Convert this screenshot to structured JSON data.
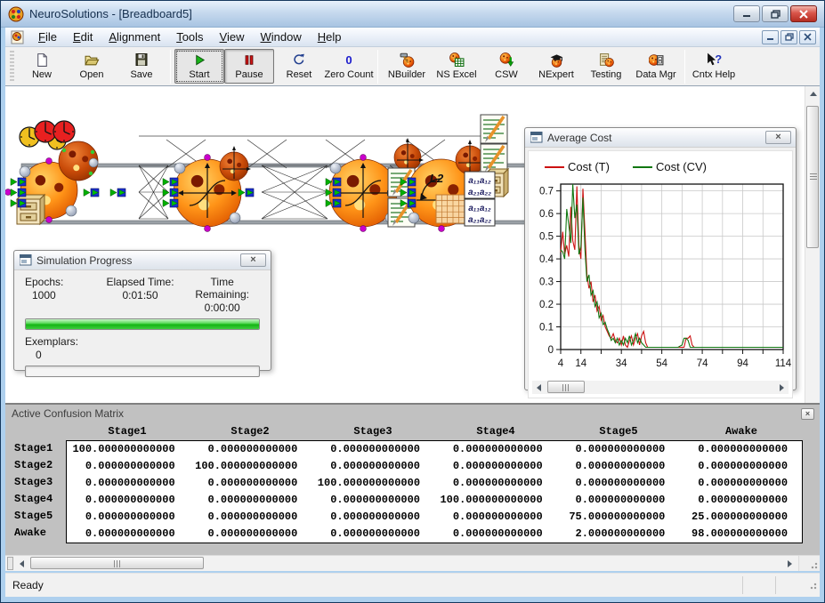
{
  "window": {
    "title": "NeuroSolutions - [Breadboard5]",
    "controls": [
      "minimize-icon",
      "restore-icon",
      "close-icon"
    ],
    "mdi_controls": [
      "minimize-icon",
      "restore-icon",
      "close-icon"
    ]
  },
  "menu": {
    "items": [
      "File",
      "Edit",
      "Alignment",
      "Tools",
      "View",
      "Window",
      "Help"
    ]
  },
  "toolbar": {
    "groups": [
      {
        "buttons": [
          {
            "label": "New",
            "icon": "new-document-icon"
          },
          {
            "label": "Open",
            "icon": "open-folder-icon"
          },
          {
            "label": "Save",
            "icon": "save-icon"
          }
        ]
      },
      {
        "buttons": [
          {
            "label": "Start",
            "icon": "start-icon",
            "pressed": true,
            "focused": true
          },
          {
            "label": "Pause",
            "icon": "pause-icon",
            "pressed": true
          },
          {
            "label": "Reset",
            "icon": "reset-icon"
          },
          {
            "label": "Zero Count",
            "icon": "zero-count-icon"
          }
        ]
      },
      {
        "buttons": [
          {
            "label": "NBuilder",
            "icon": "nbuilder-icon"
          },
          {
            "label": "NS Excel",
            "icon": "ns-excel-icon"
          },
          {
            "label": "CSW",
            "icon": "csw-icon"
          },
          {
            "label": "NExpert",
            "icon": "nexpert-icon"
          },
          {
            "label": "Testing",
            "icon": "testing-icon"
          },
          {
            "label": "Data Mgr",
            "icon": "data-mgr-icon"
          }
        ]
      },
      {
        "buttons": [
          {
            "label": "Cntx Help",
            "icon": "context-help-icon"
          }
        ]
      }
    ]
  },
  "breadboard": {
    "icons": [
      "clock-icons",
      "file-input-icon",
      "input-axon-icon",
      "hidden-axon-icon",
      "tanh-axon-icon",
      "l2-criterion-icon",
      "lm-controller-icon",
      "full-synapse-icon",
      "probe-icon",
      "weight-matrix-icon",
      "grid-icon",
      "gradient-search-icon"
    ]
  },
  "simulation_progress": {
    "title": "Simulation Progress",
    "fields": [
      {
        "label": "Epochs:",
        "value": "1000"
      },
      {
        "label": "Elapsed Time:",
        "value": "0:01:50"
      },
      {
        "label": "Time Remaining:",
        "value": "0:00:00"
      }
    ],
    "epochs_progress_percent": 100,
    "exemplars_label": "Exemplars:",
    "exemplars_value": "0",
    "exemplars_progress_percent": 0
  },
  "average_cost": {
    "title": "Average Cost",
    "chart_data": {
      "type": "line",
      "title": "Average Cost",
      "xlabel": "",
      "ylabel": "",
      "grid": true,
      "legend": "top",
      "ylim": [
        0,
        0.73
      ],
      "yticks": [
        "0",
        "0.1",
        "0.2",
        "0.3",
        "0.4",
        "0.5",
        "0.6",
        "0.7"
      ],
      "xticks": [
        4,
        14,
        34,
        54,
        74,
        94,
        114
      ],
      "x": [
        4,
        5,
        6,
        7,
        8,
        9,
        10,
        11,
        12,
        13,
        14,
        15,
        16,
        17,
        18,
        19,
        20,
        21,
        22,
        23,
        24,
        25,
        26,
        27,
        28,
        29,
        30,
        31,
        32,
        33,
        34,
        35,
        36,
        37,
        38,
        39,
        40,
        41,
        42,
        43,
        44,
        45,
        46,
        47,
        48,
        49,
        50,
        52,
        54,
        56,
        58,
        60,
        62,
        64,
        65,
        66,
        67,
        68,
        69,
        70,
        72,
        75,
        80,
        85,
        90,
        95,
        100,
        105,
        110,
        114
      ],
      "series": [
        {
          "name": "Cost (T)",
          "color": "#cc1111",
          "values": [
            0.43,
            0.52,
            0.42,
            0.46,
            0.41,
            0.63,
            0.48,
            0.44,
            0.72,
            0.46,
            0.4,
            0.71,
            0.52,
            0.33,
            0.27,
            0.3,
            0.21,
            0.24,
            0.17,
            0.19,
            0.13,
            0.15,
            0.1,
            0.08,
            0.06,
            0.05,
            0.07,
            0.04,
            0.03,
            0.05,
            0.02,
            0.06,
            0.02,
            0.01,
            0.04,
            0.06,
            0.02,
            0.05,
            0.07,
            0.02,
            0.06,
            0.08,
            0.03,
            0.01,
            0.01,
            0.01,
            0.01,
            0.01,
            0.01,
            0.01,
            0.01,
            0.01,
            0.01,
            0.01,
            0.01,
            0.05,
            0.05,
            0.06,
            0.02,
            0.01,
            0.01,
            0.01,
            0.01,
            0.01,
            0.01,
            0.01,
            0.01,
            0.01,
            0.01,
            0.01
          ]
        },
        {
          "name": "Cost (CV)",
          "color": "#117711",
          "values": [
            0.44,
            0.43,
            0.4,
            0.62,
            0.55,
            0.47,
            0.73,
            0.58,
            0.64,
            0.42,
            0.45,
            0.67,
            0.44,
            0.3,
            0.33,
            0.24,
            0.26,
            0.19,
            0.21,
            0.14,
            0.16,
            0.11,
            0.12,
            0.09,
            0.07,
            0.04,
            0.05,
            0.03,
            0.05,
            0.02,
            0.04,
            0.02,
            0.05,
            0.03,
            0.06,
            0.02,
            0.04,
            0.07,
            0.03,
            0.05,
            0.03,
            0.02,
            0.01,
            0.01,
            0.01,
            0.01,
            0.01,
            0.01,
            0.01,
            0.01,
            0.01,
            0.01,
            0.01,
            0.02,
            0.05,
            0.05,
            0.04,
            0.01,
            0.01,
            0.01,
            0.01,
            0.01,
            0.01,
            0.01,
            0.01,
            0.01,
            0.01,
            0.01,
            0.01,
            0.01
          ]
        }
      ]
    }
  },
  "confusion_matrix": {
    "title": "Active Confusion Matrix",
    "columns": [
      "Stage1",
      "Stage2",
      "Stage3",
      "Stage4",
      "Stage5",
      "Awake"
    ],
    "rows": [
      {
        "label": "Stage1",
        "values": [
          "100.000000000000",
          "0.000000000000",
          "0.000000000000",
          "0.000000000000",
          "0.000000000000",
          "0.000000000000"
        ]
      },
      {
        "label": "Stage2",
        "values": [
          "0.000000000000",
          "100.000000000000",
          "0.000000000000",
          "0.000000000000",
          "0.000000000000",
          "0.000000000000"
        ]
      },
      {
        "label": "Stage3",
        "values": [
          "0.000000000000",
          "0.000000000000",
          "100.000000000000",
          "0.000000000000",
          "0.000000000000",
          "0.000000000000"
        ]
      },
      {
        "label": "Stage4",
        "values": [
          "0.000000000000",
          "0.000000000000",
          "0.000000000000",
          "100.000000000000",
          "0.000000000000",
          "0.000000000000"
        ]
      },
      {
        "label": "Stage5",
        "values": [
          "0.000000000000",
          "0.000000000000",
          "0.000000000000",
          "0.000000000000",
          "75.000000000000",
          "25.000000000000"
        ]
      },
      {
        "label": "Awake",
        "values": [
          "0.000000000000",
          "0.000000000000",
          "0.000000000000",
          "0.000000000000",
          "2.000000000000",
          "98.000000000000"
        ]
      }
    ]
  },
  "status_bar": {
    "text": "Ready"
  },
  "colors": {
    "cost_t": "#cc1111",
    "cost_cv": "#117711",
    "progress_green": "#14b514",
    "titlebar_blue": "#c6d9ee",
    "panel_gray": "#c1c1c1"
  }
}
